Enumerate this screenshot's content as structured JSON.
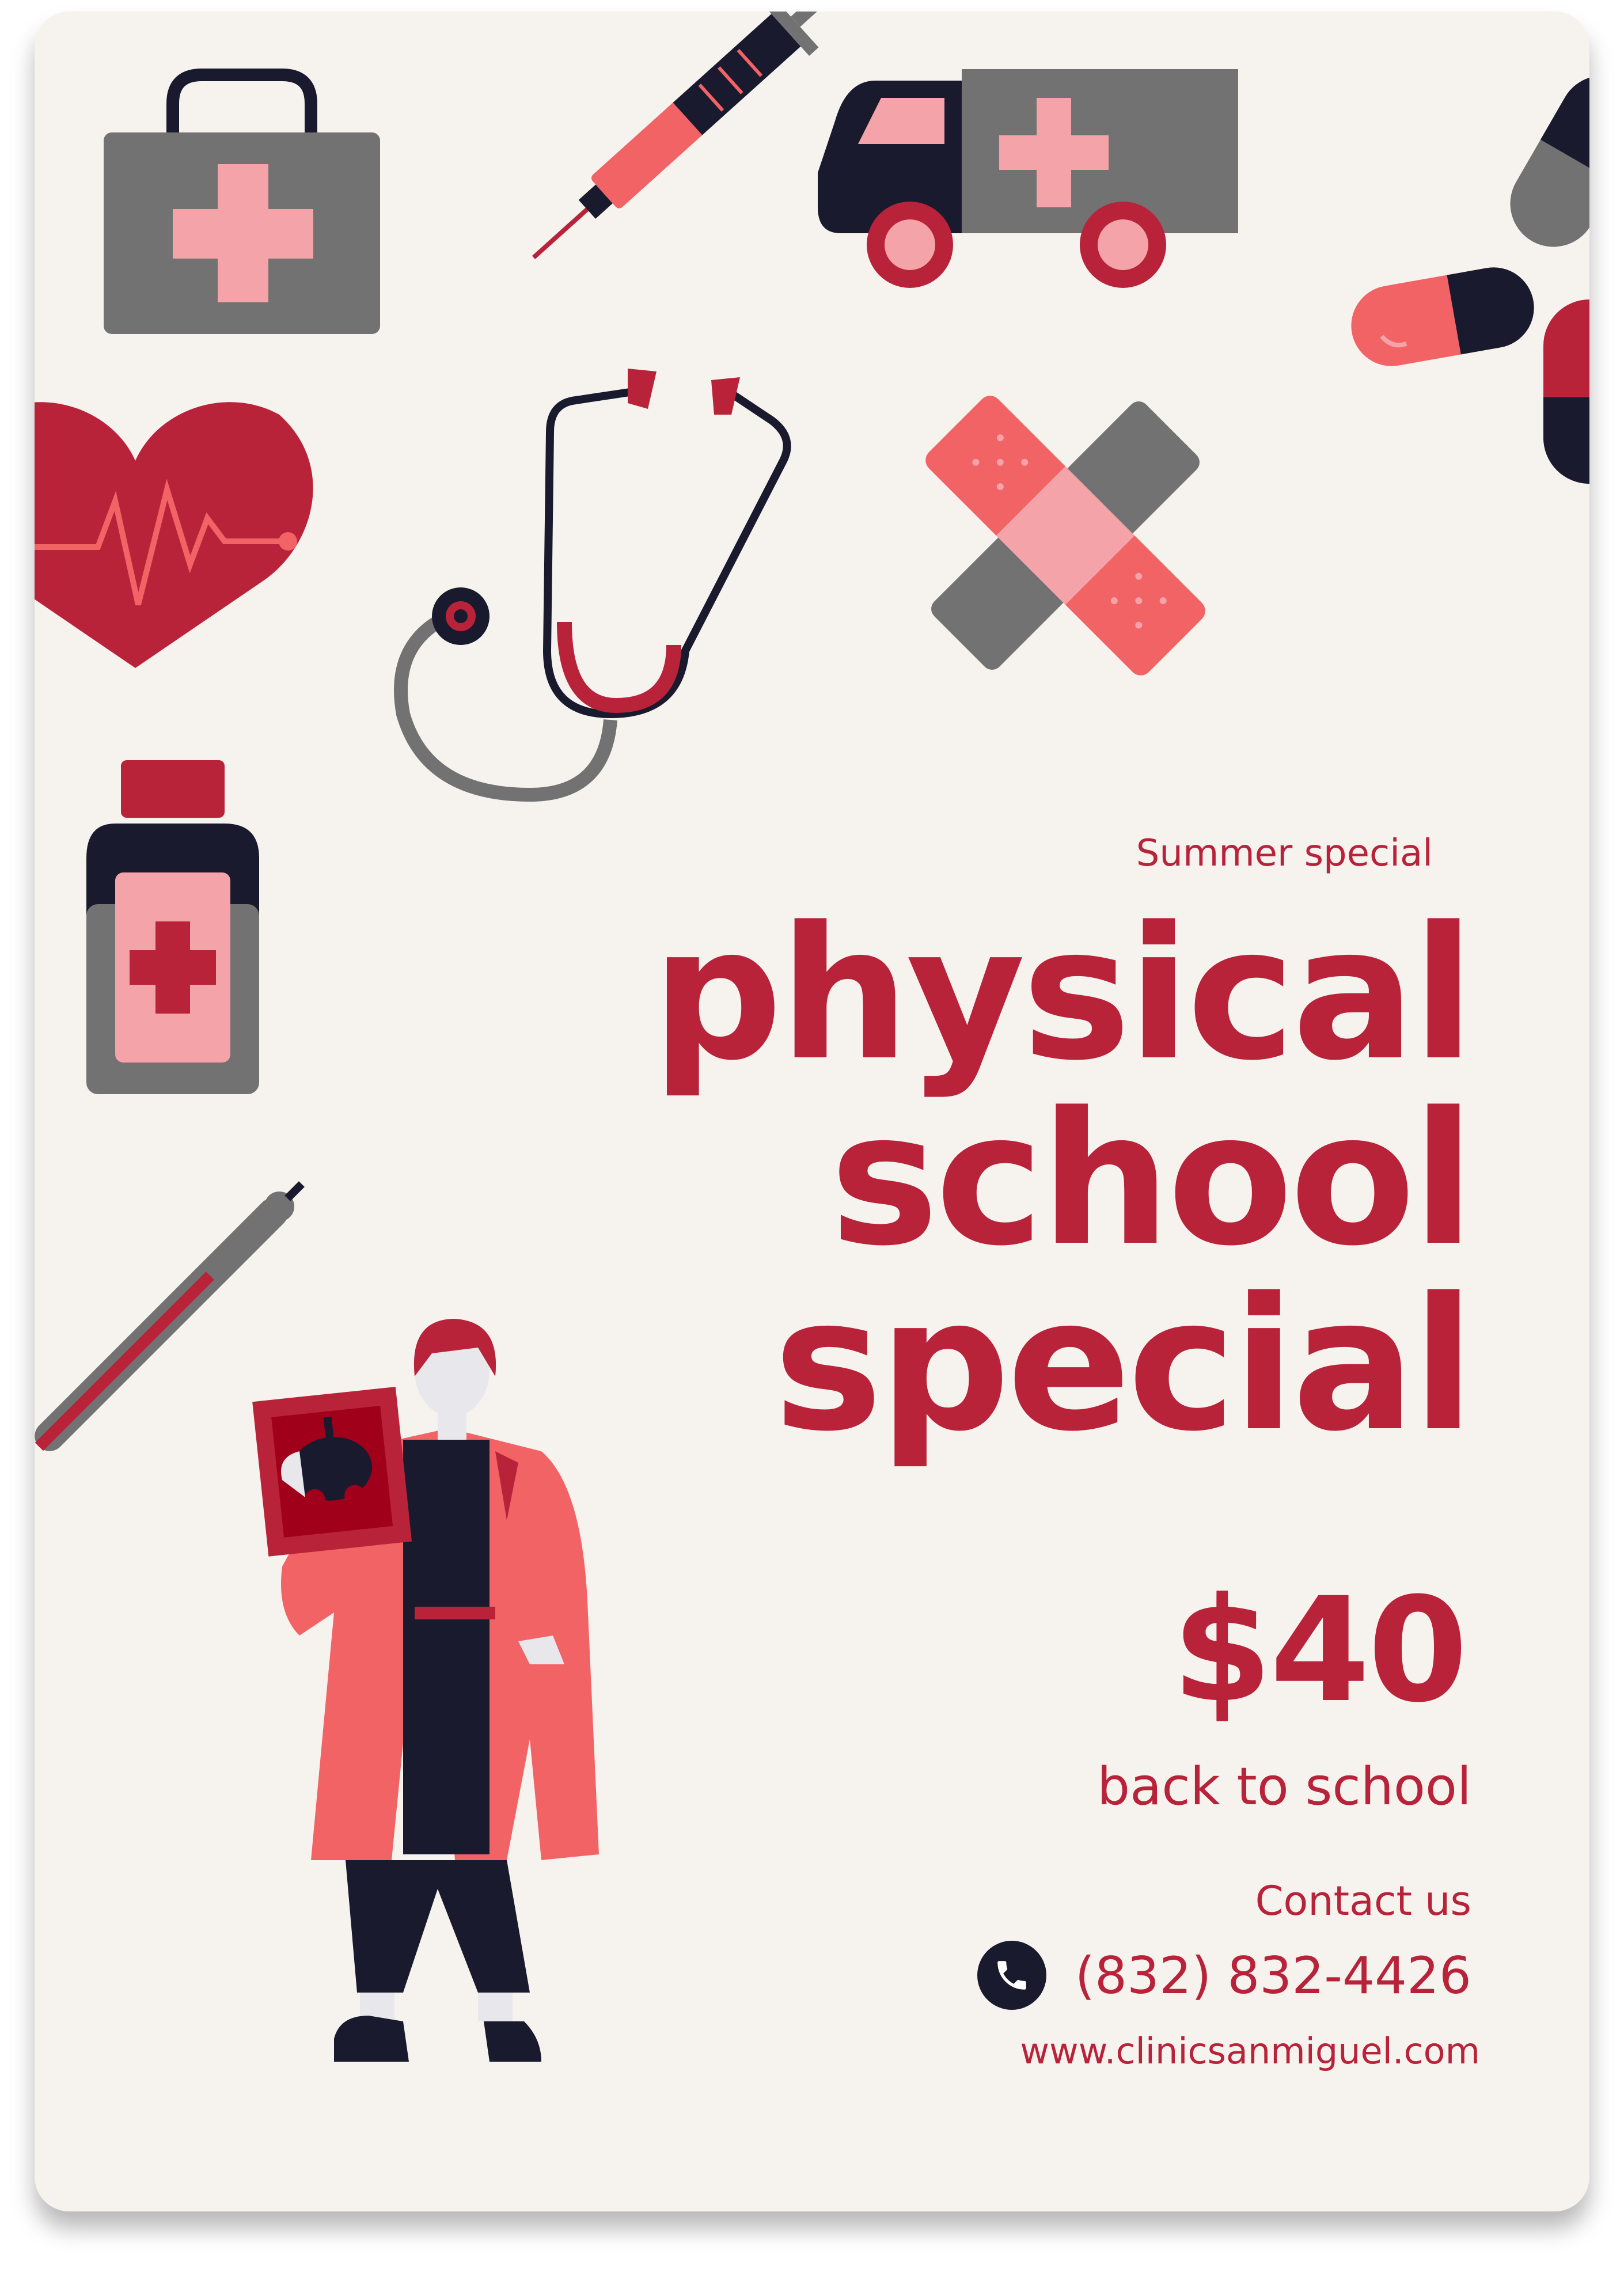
{
  "poster": {
    "kicker": "Summer special",
    "headline": [
      "physical",
      "school",
      "special"
    ],
    "price": "$40",
    "tagline": "back to school",
    "contact_label": "Contact us",
    "phone": "(832) 832-4426",
    "website": "www.clinicsanmiguel.com"
  },
  "icons": [
    "first-aid-kit-icon",
    "syringe-icon",
    "ambulance-icon",
    "pill-capsule-icon",
    "heartbeat-heart-icon",
    "stethoscope-icon",
    "bandage-icon",
    "medicine-bottle-icon",
    "thermometer-icon",
    "doctor-holding-xray-illustration",
    "phone-icon"
  ],
  "colors": {
    "background": "#f6f3ef",
    "primary_red": "#b8233a",
    "coral": "#f26366",
    "pink": "#f4a3a8",
    "gray": "#727272",
    "navy": "#1a1a2e"
  }
}
